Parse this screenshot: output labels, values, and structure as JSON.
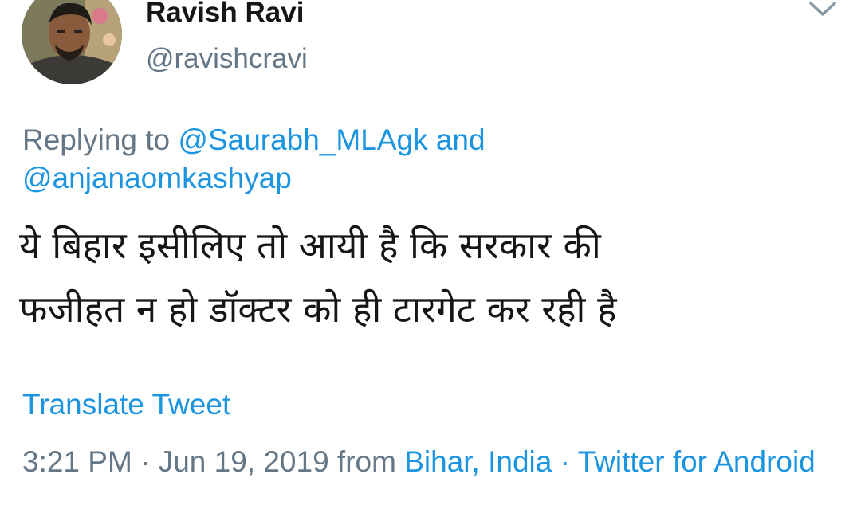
{
  "user": {
    "display_name": "Ravish Ravi",
    "handle": "@ravishcravi",
    "avatar_icon": "user-avatar-photo"
  },
  "menu": {
    "icon": "chevron-down-icon"
  },
  "reply": {
    "prefix": "Replying to ",
    "user1": "@Saurabh_MLAgk",
    "conjunction": " and",
    "user2": "@anjanaomkashyap"
  },
  "tweet": {
    "text_line1": "ये बिहार इसीलिए तो आयी है कि सरकार की",
    "text_line2": "फजीहत न हो डॉक्टर को ही टारगेट कर रही है"
  },
  "translate_label": "Translate Tweet",
  "meta": {
    "time": "3:21 PM",
    "separator1": " · ",
    "date": "Jun 19, 2019",
    "from_label": " from ",
    "location": "Bihar, India",
    "separator2": " · ",
    "source": "Twitter for Android"
  },
  "colors": {
    "link": "#1b95e0",
    "secondary_text": "#657786",
    "primary_text": "#14171a"
  }
}
